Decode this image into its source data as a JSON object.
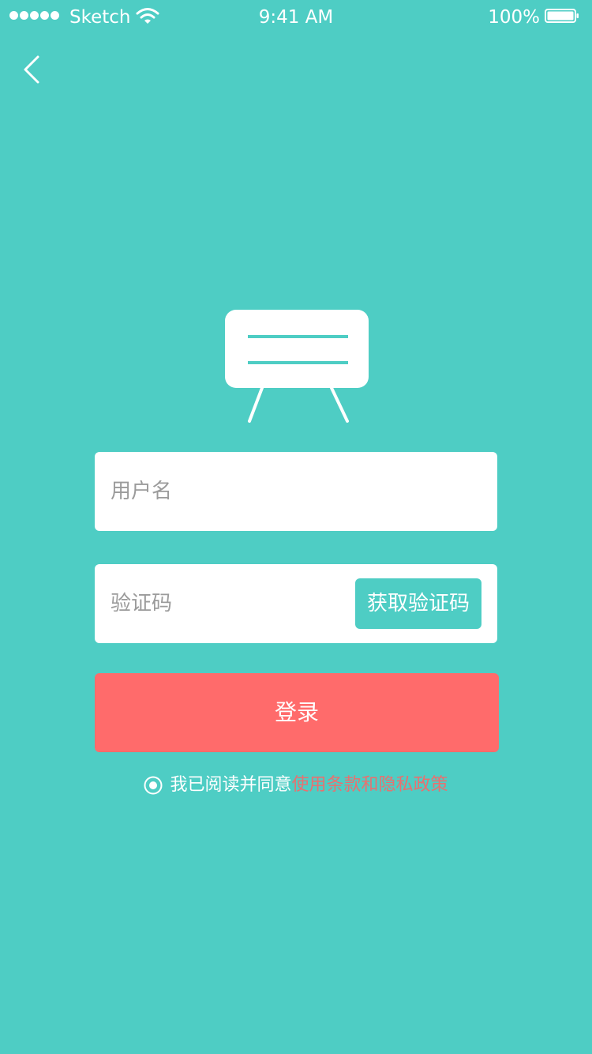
{
  "status_bar": {
    "carrier": "Sketch",
    "time": "9:41 AM",
    "battery": "100%"
  },
  "icons": {
    "back": "chevron-left-icon",
    "logo": "billboard-icon",
    "radio": "radio-checked-icon",
    "signal": "signal-dots-icon",
    "wifi": "wifi-icon",
    "battery": "battery-icon"
  },
  "form": {
    "username_placeholder": "用户名",
    "code_placeholder": "验证码",
    "get_code_label": "获取验证码",
    "login_label": "登录"
  },
  "agreement": {
    "text": "我已阅读并同意",
    "link_text": "使用条款和隐私政策",
    "checked": true
  },
  "colors": {
    "background": "#4ECDC4",
    "primary": "#4ECDC4",
    "login_button": "#FF6B6B",
    "link": "#E9706F"
  }
}
